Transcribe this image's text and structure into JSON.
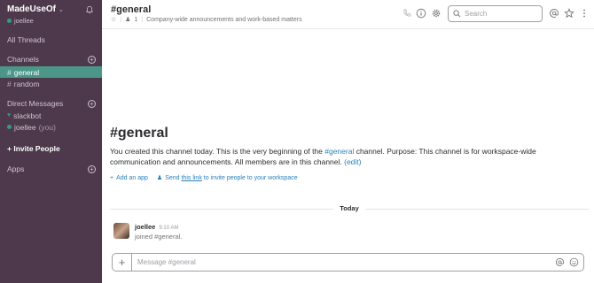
{
  "team": {
    "name": "MadeUseOf",
    "user": "joellee"
  },
  "sidebar": {
    "all_threads": "All Threads",
    "channels_label": "Channels",
    "channels": [
      {
        "name": "general"
      },
      {
        "name": "random"
      }
    ],
    "dm_label": "Direct Messages",
    "dms": [
      {
        "name": "slackbot",
        "suffix": ""
      },
      {
        "name": "joellee",
        "suffix": "(you)"
      }
    ],
    "invite_label": "Invite People",
    "apps_label": "Apps"
  },
  "header": {
    "title": "#general",
    "member_count": "1",
    "topic": "Company-wide announcements and work-based matters",
    "search_placeholder": "Search"
  },
  "intro": {
    "title": "#general",
    "text_part1": "You created this channel today. This is the very beginning of the ",
    "channel_link": "#general",
    "text_part2": " channel. Purpose: This channel is for workspace-wide communication and announcements. All members are in this channel. ",
    "edit_link": "(edit)",
    "add_app": "Add an app",
    "send_prefix": "Send ",
    "send_link": "this link",
    "send_suffix": " to invite people to your workspace"
  },
  "divider": {
    "label": "Today"
  },
  "messages": [
    {
      "user": "joellee",
      "time": "9:10 AM",
      "text": "joined #general."
    }
  ],
  "composer": {
    "placeholder": "Message #general"
  },
  "colors": {
    "sidebar_bg": "#4d394b",
    "active_channel": "#4c9689",
    "presence": "#38978d",
    "link": "#2a80b9"
  }
}
